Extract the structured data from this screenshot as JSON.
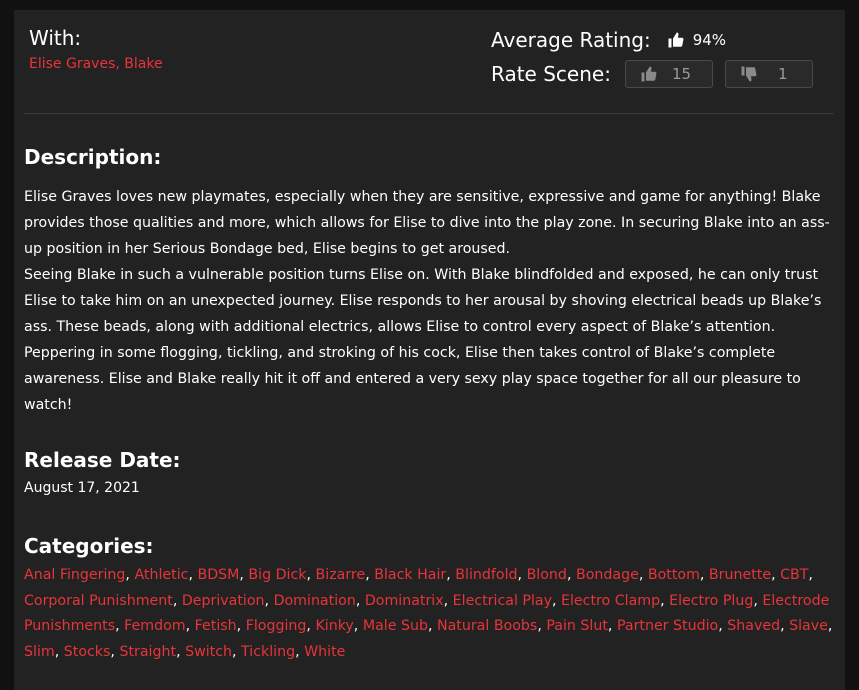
{
  "with": {
    "label": "With:",
    "performers": [
      "Elise Graves",
      "Blake"
    ]
  },
  "rating": {
    "average_label": "Average Rating:",
    "average_value": "94%",
    "rate_label": "Rate Scene:",
    "up_count": "15",
    "down_count": "1"
  },
  "description": {
    "title": "Description:",
    "paragraphs": [
      "Elise Graves loves new playmates, especially when they are sensitive, expressive and game for anything! Blake provides those qualities and more, which allows for Elise to dive into the play zone. In securing Blake into an ass-up position in her Serious Bondage bed, Elise begins to get aroused.",
      "Seeing Blake in such a vulnerable position turns Elise on. With Blake blindfolded and exposed, he can only trust Elise to take him on an unexpected journey. Elise responds to her arousal by shoving electrical beads up Blake’s ass. These beads, along with additional electrics, allows Elise to control every aspect of Blake’s attention. Peppering in some flogging, tickling, and stroking of his cock, Elise then takes control of Blake’s complete awareness. Elise and Blake really hit it off and entered a very sexy play space together for all our pleasure to watch!"
    ]
  },
  "release": {
    "title": "Release Date:",
    "date": "August 17, 2021"
  },
  "categories": {
    "title": "Categories:",
    "items": [
      "Anal Fingering",
      "Athletic",
      "BDSM",
      "Big Dick",
      "Bizarre",
      "Black Hair",
      "Blindfold",
      "Blond",
      "Bondage",
      "Bottom",
      "Brunette",
      "CBT",
      "Corporal Punishment",
      "Deprivation",
      "Domination",
      "Dominatrix",
      "Electrical Play",
      "Electro Clamp",
      "Electro Plug",
      "Electrode Punishments",
      "Femdom",
      "Fetish",
      "Flogging",
      "Kinky",
      "Male Sub",
      "Natural Boobs",
      "Pain Slut",
      "Partner Studio",
      "Shaved",
      "Slave",
      "Slim",
      "Stocks",
      "Straight",
      "Switch",
      "Tickling",
      "White"
    ]
  },
  "colors": {
    "accent": "#e8343a",
    "panel": "#222222",
    "background": "#111111"
  },
  "icons": {
    "average": "thumbs-up-icon",
    "rate_up": "thumbs-up-icon",
    "rate_down": "thumbs-down-icon"
  }
}
